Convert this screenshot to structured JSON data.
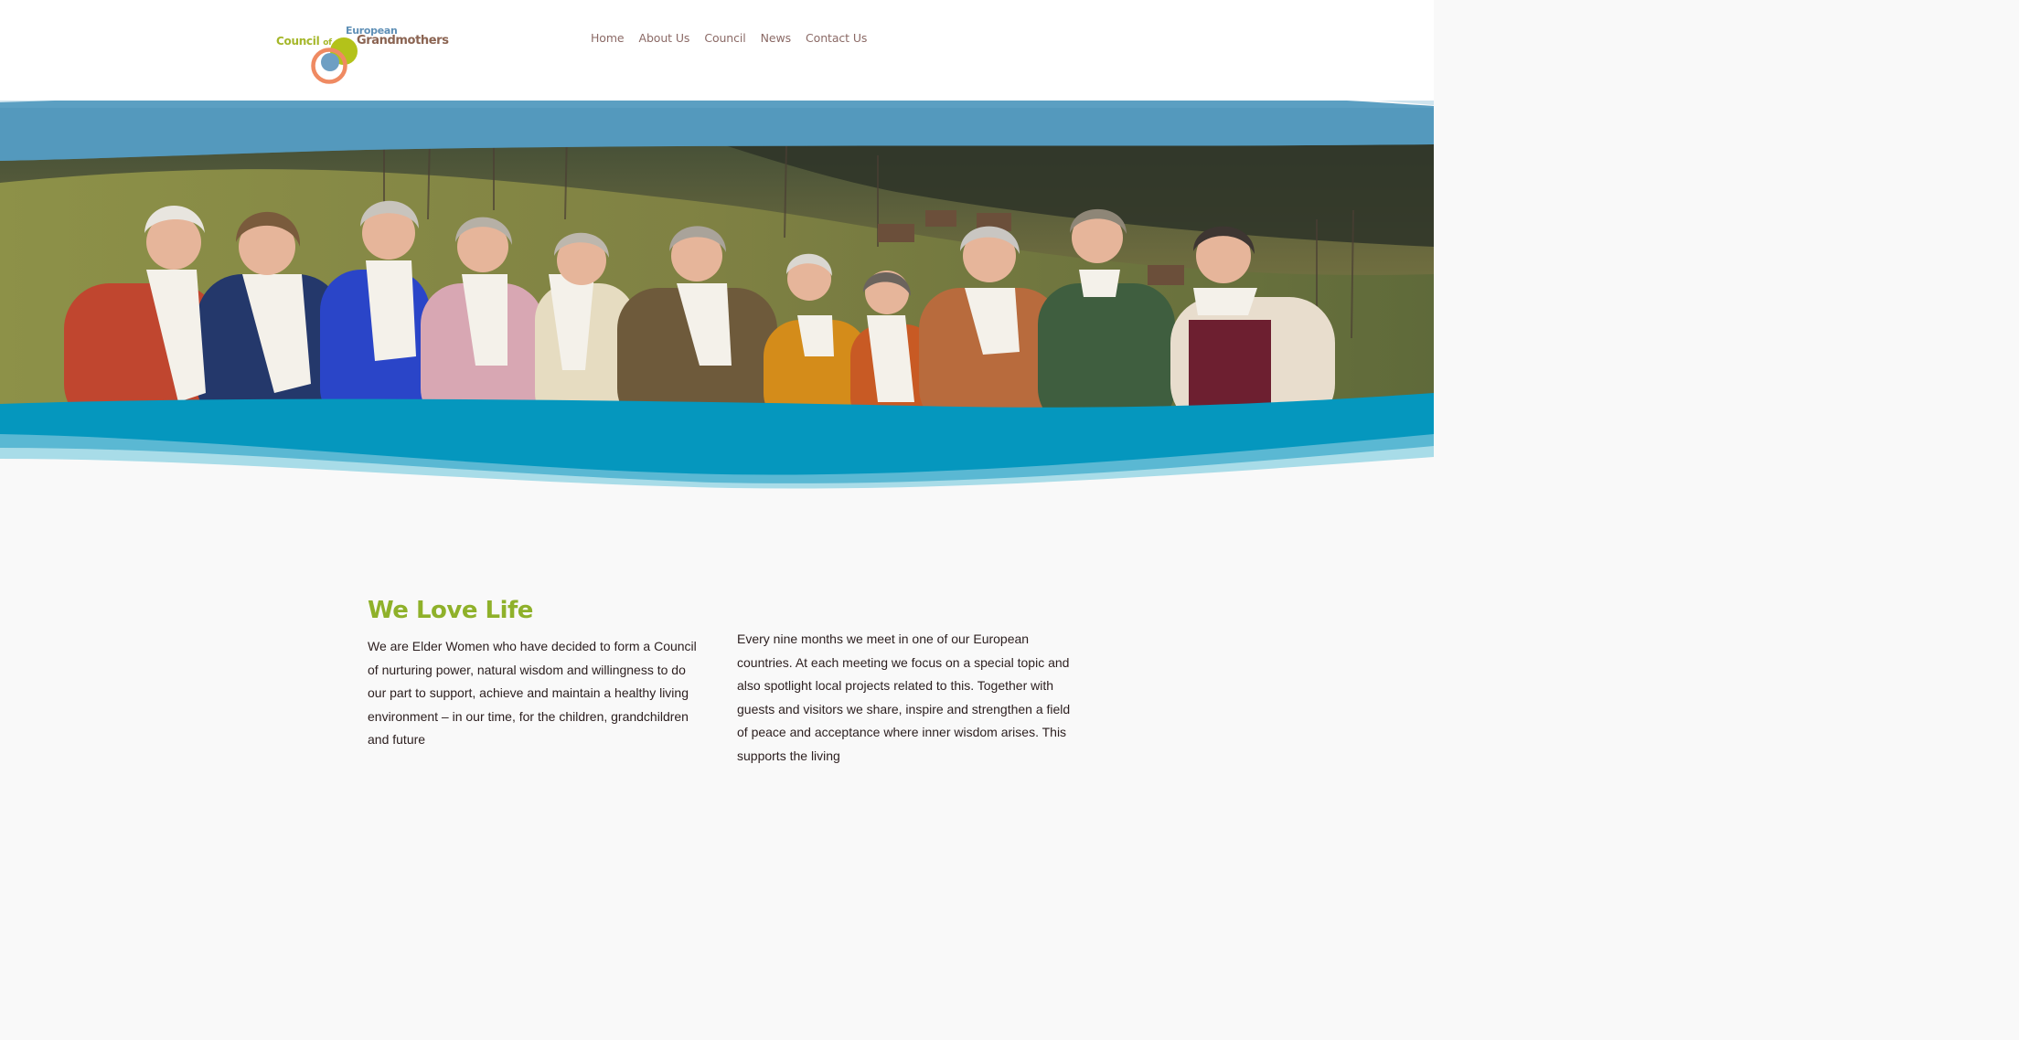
{
  "site": {
    "logo": {
      "line_council": "Council",
      "line_of": "of",
      "line_european": "European",
      "line_grandmothers": "Grandmothers",
      "colors": {
        "green": "#a5b72a",
        "blue": "#5e8fb6",
        "brown": "#8b6452",
        "orange": "#ef8a62"
      }
    }
  },
  "nav": {
    "items": [
      {
        "label": "Home"
      },
      {
        "label": "About Us"
      },
      {
        "label": "Council"
      },
      {
        "label": "News"
      },
      {
        "label": "Contact Us"
      }
    ]
  },
  "hero": {
    "image": "group-photo-of-eleven-grandmothers-in-white-scarves-on-a-mountain-meadow",
    "colors": {
      "wave_top": "#5b9fc2",
      "wave_bottom": "#0597be",
      "wave_light": "#a8dce8"
    }
  },
  "intro": {
    "heading": "We Love Life",
    "left_text": "We are Elder Women who have decided to form a Council of nurturing power, natural wisdom and willingness to do our part to support, achieve and maintain a healthy living environment – in our time, for the children, grandchildren and future",
    "right_text": "Every nine months we meet in one of our European countries. At each meeting we focus on a special topic and also spotlight local projects related to this. Together with guests and visitors we share, inspire and strengthen a field of peace and acceptance where inner wisdom arises. This supports the living",
    "colors": {
      "heading": "#8fb12a",
      "text": "#2b1e1e"
    }
  }
}
